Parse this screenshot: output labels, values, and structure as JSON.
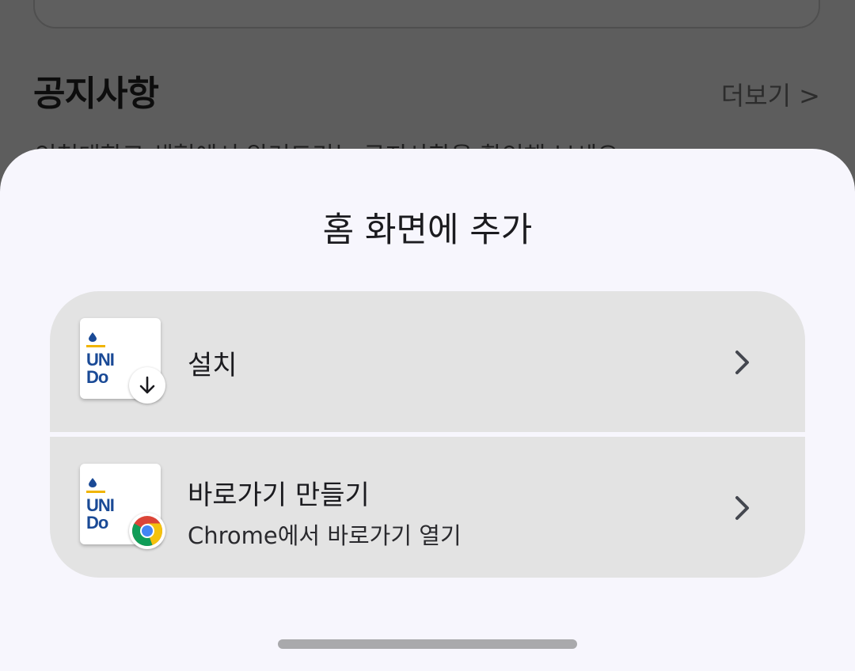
{
  "background_page": {
    "section_title": "공지사항",
    "more_link": "더보기 >",
    "notice_preview": "인천대학교 생협에서 알려드리는 공지사항을 확인해 보세요"
  },
  "sheet": {
    "title": "홈 화면에 추가",
    "options": [
      {
        "label": "설치",
        "badge_icon": "download-arrow-icon"
      },
      {
        "label": "바로가기 만들기",
        "sublabel": "Chrome에서 바로가기 열기",
        "badge_icon": "chrome-icon"
      }
    ],
    "app_logo": {
      "line1": "UNI",
      "line2": "Do"
    }
  },
  "colors": {
    "sheet_background": "#f7f6fd",
    "option_background": "#e3e3e3",
    "logo_blue": "#1a4a96",
    "logo_accent": "#f0b400",
    "scrim": "#5d5d5d"
  }
}
